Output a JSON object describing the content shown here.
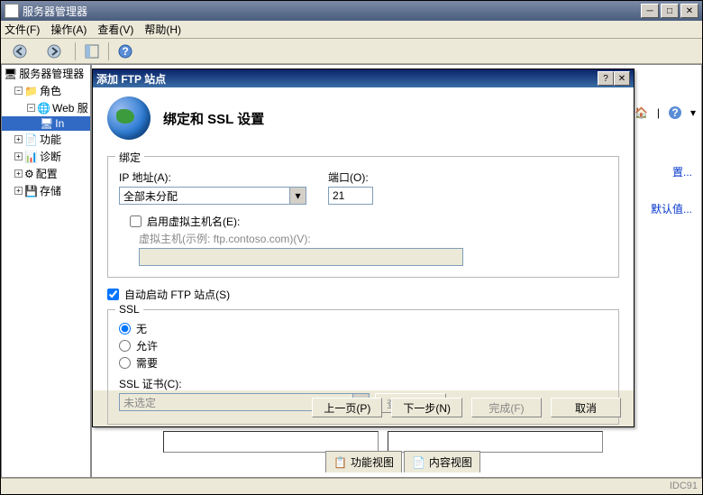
{
  "window": {
    "title": "服务器管理器",
    "menus": [
      "文件(F)",
      "操作(A)",
      "查看(V)",
      "帮助(H)"
    ]
  },
  "tree": {
    "root": "服务器管理器",
    "roles": "角色",
    "web": "Web 服",
    "in": "In",
    "features": "功能",
    "diag": "诊断",
    "config": "配置",
    "storage": "存储"
  },
  "right": {
    "link1": "置...",
    "link2": "默认值...",
    "tab1": "功能视图",
    "tab2": "内容视图"
  },
  "dialog": {
    "title": "添加 FTP 站点",
    "heading": "绑定和 SSL 设置",
    "bind_group": "绑定",
    "ip_label": "IP 地址(A):",
    "ip_value": "全部未分配",
    "port_label": "端口(O):",
    "port_value": "21",
    "vhost_chk": "启用虚拟主机名(E):",
    "vhost_hint": "虚拟主机(示例: ftp.contoso.com)(V):",
    "autostart": "自动启动 FTP 站点(S)",
    "ssl_group": "SSL",
    "ssl_none": "无",
    "ssl_allow": "允许",
    "ssl_require": "需要",
    "cert_label": "SSL 证书(C):",
    "cert_value": "未选定",
    "view_btn": "查看(W)...",
    "btn_prev": "上一页(P)",
    "btn_next": "下一步(N)",
    "btn_finish": "完成(F)",
    "btn_cancel": "取消"
  },
  "watermark": "IDC91"
}
